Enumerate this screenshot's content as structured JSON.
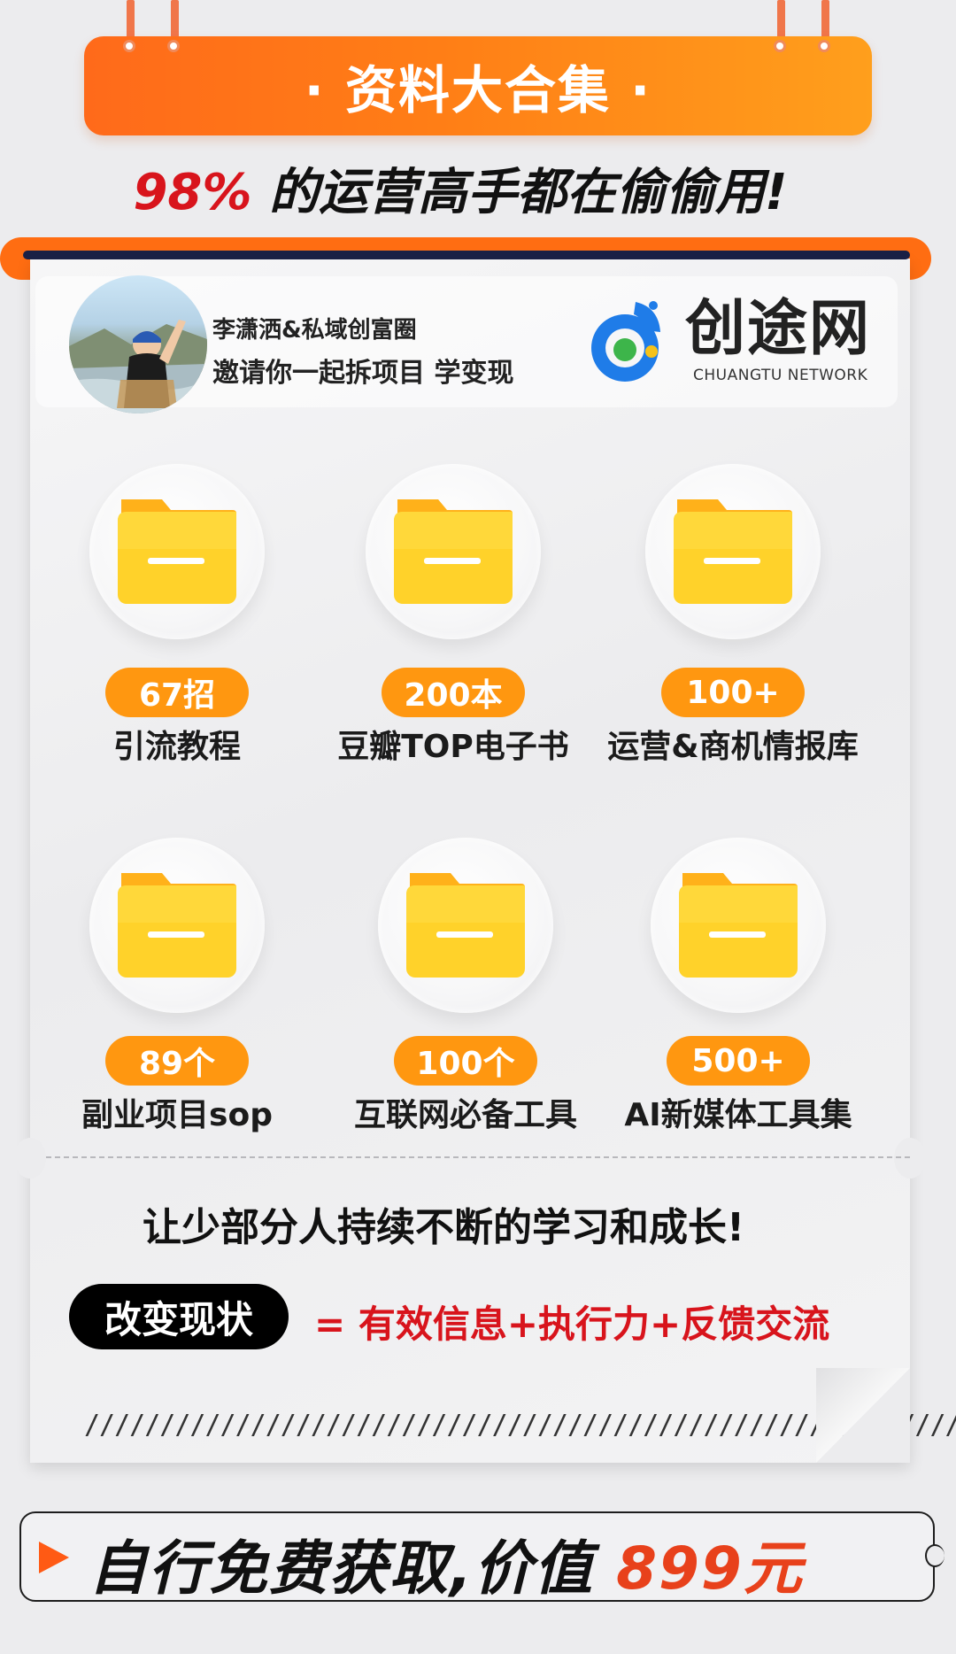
{
  "header": {
    "banner_title": "· 资料大合集 ·",
    "subtitle_pct": "98%",
    "subtitle_text": " 的运营高手都在偷偷用!"
  },
  "profile": {
    "invite_line1": "李潇洒&私域创富圈",
    "invite_line2": "邀请你一起拆项目 学变现",
    "brand_name": "创途网",
    "brand_en": "CHUANGTU NETWORK"
  },
  "resources": [
    {
      "count": "67招",
      "label": "引流教程"
    },
    {
      "count": "200本",
      "label": "豆瓣TOP电子书"
    },
    {
      "count": "100+",
      "label": "运营&商机情报库"
    },
    {
      "count": "89个",
      "label": "副业项目sop"
    },
    {
      "count": "100个",
      "label": "互联网必备工具"
    },
    {
      "count": "500+",
      "label": "AI新媒体工具集"
    }
  ],
  "motto": {
    "slogan": "让少部分人持续不断的学习和成长!",
    "pill": "改变现状",
    "formula": "= 有效信息+执行力+反馈交流"
  },
  "cta": {
    "text": "自行免费获取,价值 ",
    "value": "899元"
  },
  "colors": {
    "accent_orange": "#ff7e16",
    "badge_orange": "#ff9710",
    "red": "#d8141c",
    "navy": "#192045"
  },
  "icons": [
    "folder-icon",
    "play-triangle-icon",
    "chuangtu-logo-icon"
  ]
}
